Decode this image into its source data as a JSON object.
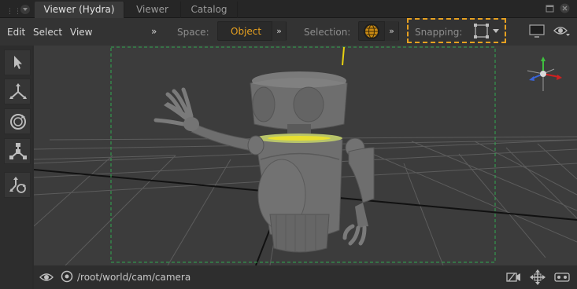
{
  "tabs": [
    {
      "label": "Viewer (Hydra)",
      "active": true
    },
    {
      "label": "Viewer",
      "active": false
    },
    {
      "label": "Catalog",
      "active": false
    }
  ],
  "menu": [
    "Edit",
    "Select",
    "View"
  ],
  "toolbar": {
    "space_label": "Space:",
    "space_value": "Object",
    "selection_label": "Selection:",
    "snapping_label": "Snapping:",
    "chevron": "»"
  },
  "tools": [
    "select-arrow-icon",
    "translate-icon",
    "rotate-icon",
    "scale-icon",
    "camera-orbit-icon"
  ],
  "bottom": {
    "camera_path": "/root/world/cam/camera"
  },
  "colors": {
    "accent": "#e6a020",
    "frame_guide": "#2fa84f",
    "grid": "#5a5a5a",
    "background": "#3c3c3c"
  }
}
